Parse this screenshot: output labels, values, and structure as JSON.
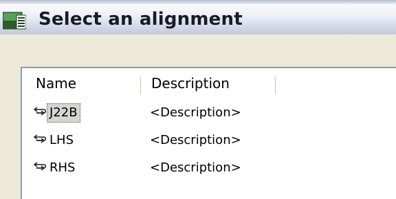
{
  "window": {
    "title": "Select an alignment",
    "icon": "app-window-icon"
  },
  "alignment_list": {
    "columns": [
      {
        "label": "Name"
      },
      {
        "label": "Description"
      }
    ],
    "rows": [
      {
        "name": "J22B",
        "description": "<Description>",
        "icon": "alignment-icon",
        "selected": true
      },
      {
        "name": "LHS",
        "description": "<Description>",
        "icon": "alignment-icon",
        "selected": false
      },
      {
        "name": "RHS",
        "description": "<Description>",
        "icon": "alignment-icon",
        "selected": false
      }
    ]
  },
  "colors": {
    "list_border": "#7f9db9",
    "selection_background": "#d6d5d0",
    "dialog_background": "#ece9d8"
  }
}
